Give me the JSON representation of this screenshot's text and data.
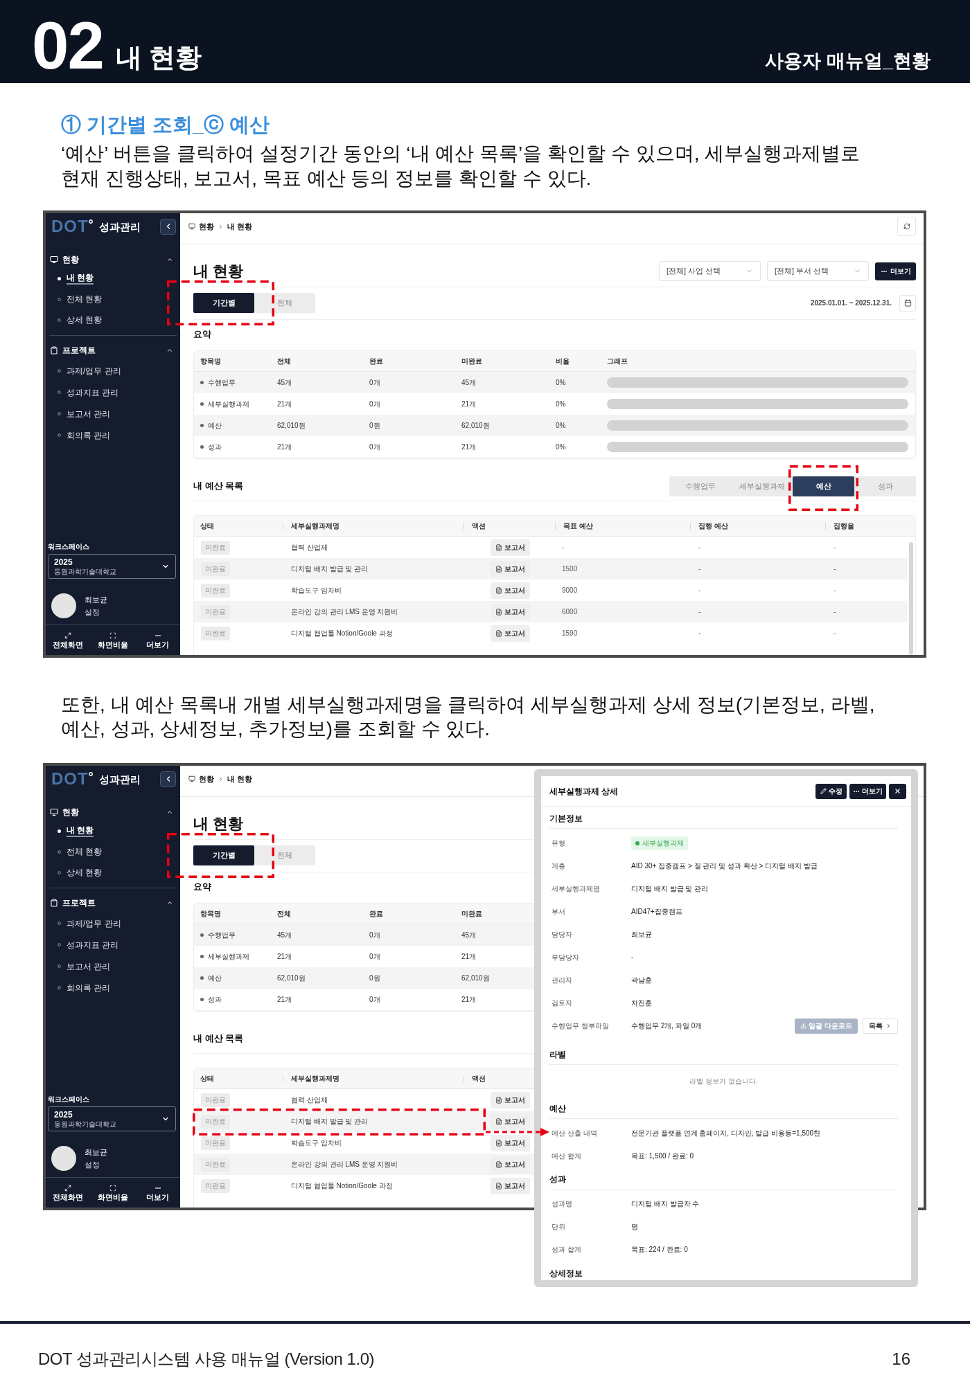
{
  "header": {
    "chapter": "02",
    "title": "내 현황",
    "section_name": "사용자 매뉴얼_현황"
  },
  "section": {
    "heading": "① 기간별 조회_ⓒ 예산",
    "description": "‘예산’ 버튼을 클릭하여 설정기간 동안의 ‘내 예산 목록’을 확인할 수 있으며, 세부실행과제별로 현재 진행상태, 보고서, 목표 예산 등의 정보를 확인할 수 있다."
  },
  "screenshot_1": {
    "sidebar": {
      "logo": {
        "mark": "DOT",
        "text": "성과관리"
      },
      "groups": [
        {
          "label": "현황",
          "kind": "monitor",
          "expanded": true,
          "items": [
            {
              "label": "내 현황",
              "selected": true
            },
            {
              "label": "전체 현황",
              "selected": false
            },
            {
              "label": "상세 현황",
              "selected": false
            }
          ]
        },
        {
          "label": "프로젝트",
          "kind": "clipboard",
          "expanded": true,
          "items": [
            {
              "label": "과제/업무 관리",
              "selected": false
            },
            {
              "label": "성과지표 관리",
              "selected": false
            },
            {
              "label": "보고서 관리",
              "selected": false
            },
            {
              "label": "회의록 관리",
              "selected": false
            }
          ]
        }
      ],
      "workspace": {
        "label": "워크스페이스",
        "year": "2025",
        "organization": "동원과학기술대학교"
      },
      "user": {
        "name": "최보균",
        "settings": "설정"
      },
      "footer_buttons": [
        {
          "label": "전체화면",
          "kind": "expand"
        },
        {
          "label": "화면비율",
          "kind": "frame"
        },
        {
          "label": "더보기",
          "kind": "more"
        }
      ]
    },
    "breadcrumb": [
      "현황",
      "내 현황"
    ],
    "title": "내 현황",
    "filters": [
      {
        "value": "[전체] 사업 선택"
      },
      {
        "value": "[전체] 부서 선택"
      }
    ],
    "more_button": "더보기",
    "period_tabs": {
      "highlighted": true,
      "items": [
        {
          "label": "기간별",
          "selected": true
        },
        {
          "label": "전체",
          "selected": false
        }
      ]
    },
    "date_range": "2025.01.01. ~ 2025.12.31.",
    "summary": {
      "title": "요약",
      "columns": [
        "항목명",
        "전체",
        "완료",
        "미완료",
        "비율",
        "그래프"
      ],
      "rows": [
        {
          "name": "수행업무",
          "total": "45개",
          "done": "0개",
          "remaining": "45개",
          "ratio": "0%",
          "level": 0
        },
        {
          "name": "세부실행과제",
          "total": "21개",
          "done": "0개",
          "remaining": "21개",
          "ratio": "0%",
          "level": 0
        },
        {
          "name": "예산",
          "total": "62,010원",
          "done": "0원",
          "remaining": "62,010원",
          "ratio": "0%",
          "level": 0
        },
        {
          "name": "성과",
          "total": "21개",
          "done": "0개",
          "remaining": "21개",
          "ratio": "0%",
          "level": 0
        }
      ]
    },
    "budget_list": {
      "title": "내 예산 목록",
      "tabs": [
        {
          "label": "수행업무",
          "selected": false,
          "highlighted": false
        },
        {
          "label": "세부실행과제",
          "selected": false,
          "highlighted": false
        },
        {
          "label": "예산",
          "selected": true,
          "highlighted": true
        },
        {
          "label": "성과",
          "selected": false,
          "highlighted": false
        }
      ],
      "columns": [
        "상태",
        "세부실행과제명",
        "액션",
        "목표 예산",
        "집행 예산",
        "집행율"
      ],
      "rows": [
        {
          "status": "미완료",
          "name": "협력 산업체",
          "action": "보고서",
          "target": "-",
          "spent": "-",
          "rate": "-"
        },
        {
          "status": "미완료",
          "name": "디지털 배지 발급 및 관리",
          "action": "보고서",
          "target": "1500",
          "spent": "-",
          "rate": "-"
        },
        {
          "status": "미완료",
          "name": "학습도구 임차비",
          "action": "보고서",
          "target": "9000",
          "spent": "-",
          "rate": "-"
        },
        {
          "status": "미완료",
          "name": "온라인 강의 관리 LMS 운영 지원비",
          "action": "보고서",
          "target": "6000",
          "spent": "-",
          "rate": "-"
        },
        {
          "status": "미완료",
          "name": "디지털 협업툴 Notion/Goole 과정",
          "action": "보고서",
          "target": "1590",
          "spent": "-",
          "rate": "-"
        }
      ]
    }
  },
  "paragraph_2": "또한, 내 예산 목록내 개별 세부실행과제명을 클릭하여 세부실행과제 상세 정보(기본정보, 라벨, 예산, 성과, 상세정보, 추가정보)를 조회할 수 있다.",
  "screenshot_2": {
    "sidebar": {
      "logo": {
        "mark": "DOT",
        "text": "성과관리"
      },
      "groups": [
        {
          "label": "현황",
          "kind": "monitor",
          "expanded": true,
          "items": [
            {
              "label": "내 현황",
              "selected": true
            },
            {
              "label": "전체 현황",
              "selected": false
            },
            {
              "label": "상세 현황",
              "selected": false
            }
          ]
        },
        {
          "label": "프로젝트",
          "kind": "clipboard",
          "expanded": true,
          "items": [
            {
              "label": "과제/업무 관리",
              "selected": false
            },
            {
              "label": "성과지표 관리",
              "selected": false
            },
            {
              "label": "보고서 관리",
              "selected": false
            },
            {
              "label": "회의록 관리",
              "selected": false
            }
          ]
        }
      ],
      "workspace": {
        "label": "워크스페이스",
        "year": "2025",
        "organization": "동원과학기술대학교"
      },
      "user": {
        "name": "최보균",
        "settings": "설정"
      },
      "footer_buttons": [
        {
          "label": "전체화면",
          "kind": "expand"
        },
        {
          "label": "화면비율",
          "kind": "frame"
        },
        {
          "label": "더보기",
          "kind": "more"
        }
      ]
    },
    "breadcrumb": [
      "현황",
      "내 현황"
    ],
    "title": "내 현황",
    "period_tabs": {
      "highlighted": true,
      "items": [
        {
          "label": "기간별",
          "selected": true
        },
        {
          "label": "전체",
          "selected": false
        }
      ]
    },
    "summary": {
      "title": "요약",
      "columns": [
        "항목명",
        "전체",
        "완료",
        "미완료"
      ],
      "rows": [
        {
          "name": "수행업무",
          "total": "45개",
          "done": "0개",
          "remaining": "45개"
        },
        {
          "name": "세부실행과제",
          "total": "21개",
          "done": "0개",
          "remaining": "21개"
        },
        {
          "name": "예산",
          "total": "62,010원",
          "done": "0원",
          "remaining": "62,010원"
        },
        {
          "name": "성과",
          "total": "21개",
          "done": "0개",
          "remaining": "21개"
        }
      ]
    },
    "budget_list": {
      "title": "내 예산 목록",
      "columns": [
        "상태",
        "세부실행과제명",
        "액션"
      ],
      "rows": [
        {
          "status": "미완료",
          "name": "협력 산업체",
          "action": "보고서",
          "highlighted": false
        },
        {
          "status": "미완료",
          "name": "디지털 배지 발급 및 관리",
          "action": "보고서",
          "highlighted": true
        },
        {
          "status": "미완료",
          "name": "학습도구 임차비",
          "action": "보고서",
          "highlighted": false
        },
        {
          "status": "미완료",
          "name": "온라인 강의 관리 LMS 운영 지원비",
          "action": "보고서",
          "highlighted": false
        },
        {
          "status": "미완료",
          "name": "디지털 협업툴 Notion/Goole 과정",
          "action": "보고서",
          "highlighted": false
        }
      ]
    },
    "detail_panel": {
      "title": "세부실행과제 상세",
      "actions": [
        {
          "kind": "edit",
          "label": "수정"
        },
        {
          "kind": "more",
          "label": "더보기"
        },
        {
          "kind": "close"
        }
      ],
      "sections": [
        {
          "title": "기본정보",
          "rows": [
            {
              "label": "유형",
              "value": "세부실행과제",
              "kind": "badge"
            },
            {
              "label": "계층",
              "value": "AID 30+ 집중캠프 > 질 관리 및 성과 확산 > 디지털 배지 발급",
              "kind": "text"
            },
            {
              "label": "세부실행과제명",
              "value": "디지털 배지 발급 및 관리",
              "kind": "text"
            },
            {
              "label": "부서",
              "value": "AID47+집중캠프",
              "kind": "text"
            },
            {
              "label": "담당자",
              "value": "최보균",
              "kind": "text"
            },
            {
              "label": "부담당자",
              "value": "-",
              "kind": "text"
            },
            {
              "label": "관리자",
              "value": "곽남훈",
              "kind": "text"
            },
            {
              "label": "검토자",
              "value": "차진훈",
              "kind": "text"
            },
            {
              "label": "수행업무 첨부파일",
              "value": "수행업무 2개, 파일 0개",
              "kind": "files",
              "buttons": [
                {
                  "label": "일괄 다운로드",
                  "kind": "download",
                  "disabled": true
                },
                {
                  "label": "목록",
                  "kind": "list",
                  "disabled": false
                }
              ]
            }
          ]
        },
        {
          "title": "라벨",
          "empty_message": "라벨 정보가 없습니다."
        },
        {
          "title": "예산",
          "rows": [
            {
              "label": "예산 산출 내역",
              "value": "전문기관 플랫폼 연계 홈페이지, 디자인, 발급 비용등=1,500천",
              "kind": "text"
            },
            {
              "label": "예산 합계",
              "value": "목표: 1,500 / 완료: 0",
              "kind": "text"
            }
          ]
        },
        {
          "title": "성과",
          "rows": [
            {
              "label": "성과명",
              "value": "디지털 배지 발급자 수",
              "kind": "text"
            },
            {
              "label": "단위",
              "value": "명",
              "kind": "text"
            },
            {
              "label": "성과 합계",
              "value": "목표: 224 / 완료: 0",
              "kind": "text"
            }
          ]
        },
        {
          "title": "상세정보"
        }
      ]
    }
  },
  "footer": {
    "title": "DOT 성과관리시스템 사용 매뉴얼 (Version 1.0)",
    "page": "16"
  }
}
